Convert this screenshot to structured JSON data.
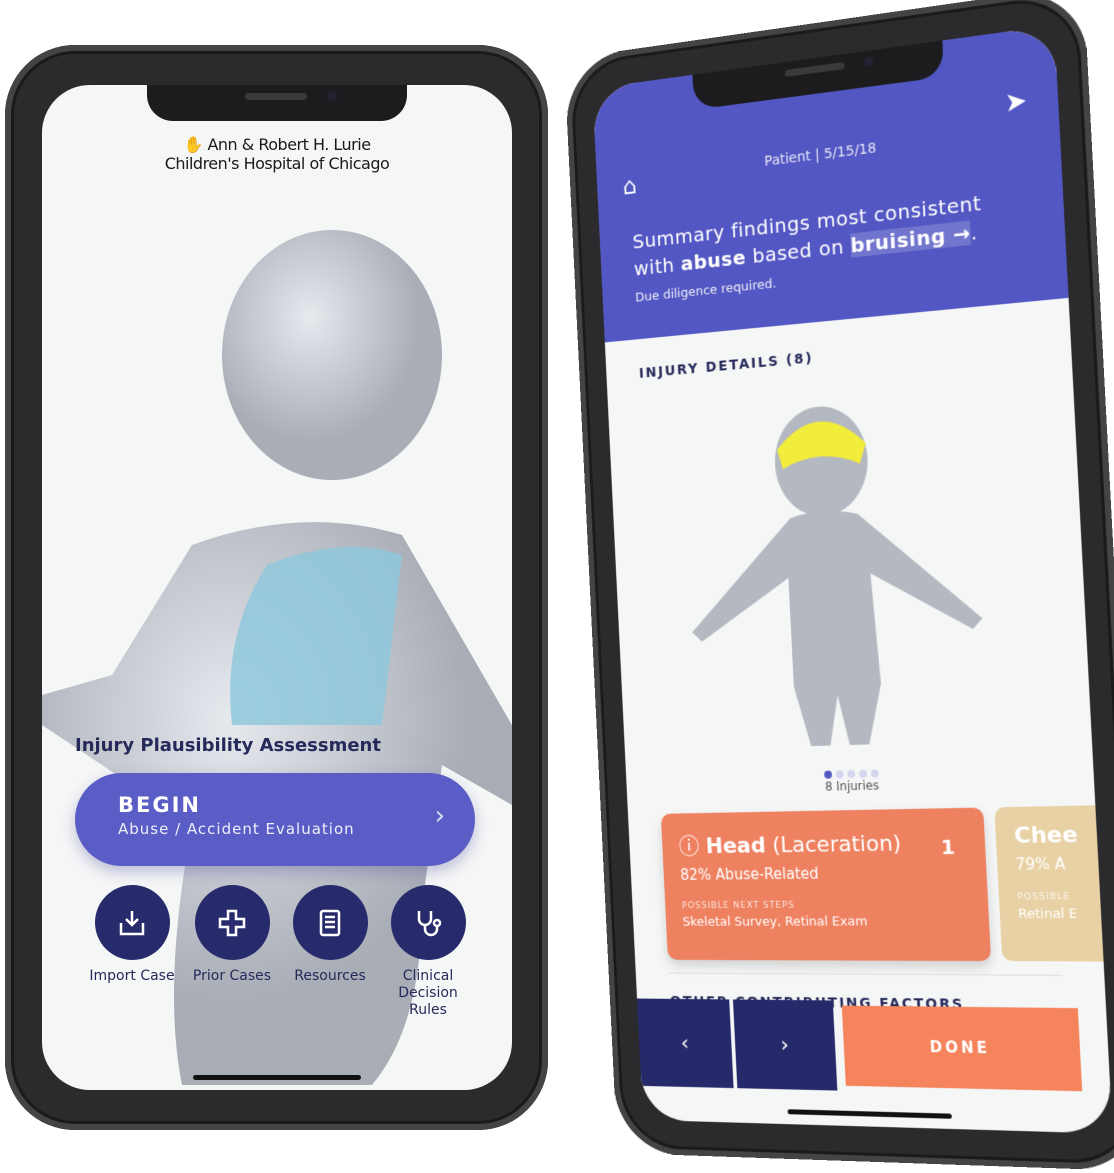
{
  "left_phone": {
    "logo": {
      "line1": "Ann & Robert H. Lurie",
      "line2": "Children's Hospital of Chicago"
    },
    "title": "Injury Plausibility Assessment",
    "begin": {
      "label": "BEGIN",
      "sub": "Abuse / Accident Evaluation"
    },
    "actions": [
      {
        "label": "Import Case",
        "icon": "import-icon"
      },
      {
        "label": "Prior Cases",
        "icon": "plus-icon"
      },
      {
        "label": "Resources",
        "icon": "book-icon"
      },
      {
        "label": "Clinical Decision Rules",
        "icon": "stethoscope-icon"
      }
    ],
    "highlight_color": "#8fc8dc"
  },
  "right_phone": {
    "header": {
      "patient": "Patient",
      "date": "5/15/18",
      "summary_1": "Summary findings most consistent",
      "summary_2a": "with ",
      "summary_bold": "abuse",
      "summary_2b": " based on ",
      "summary_link": "bruising →",
      "summary_end": ".",
      "due": "Due diligence required."
    },
    "injury_details": "INJURY DETAILS (8)",
    "carousel": {
      "pages": 5,
      "active": 1,
      "count_label": "8 Injuries"
    },
    "cards": [
      {
        "title": "Head",
        "type": "(Laceration)",
        "percent": "82% Abuse-Related",
        "next_label": "POSSIBLE NEXT STEPS",
        "next": "Skeletal Survey, Retinal Exam",
        "number": "1",
        "color": "#ee8160"
      },
      {
        "title": "Chee",
        "percent": "79% A",
        "next_label": "POSSIBLE",
        "next": "Retinal E",
        "color": "#e8d1a4"
      }
    ],
    "other": "OTHER CONTRIBUTING FACTORS",
    "prev": "‹",
    "next": "›",
    "done": "DONE",
    "accent": "#5357c3",
    "highlight_color": "#f2ec3a"
  }
}
